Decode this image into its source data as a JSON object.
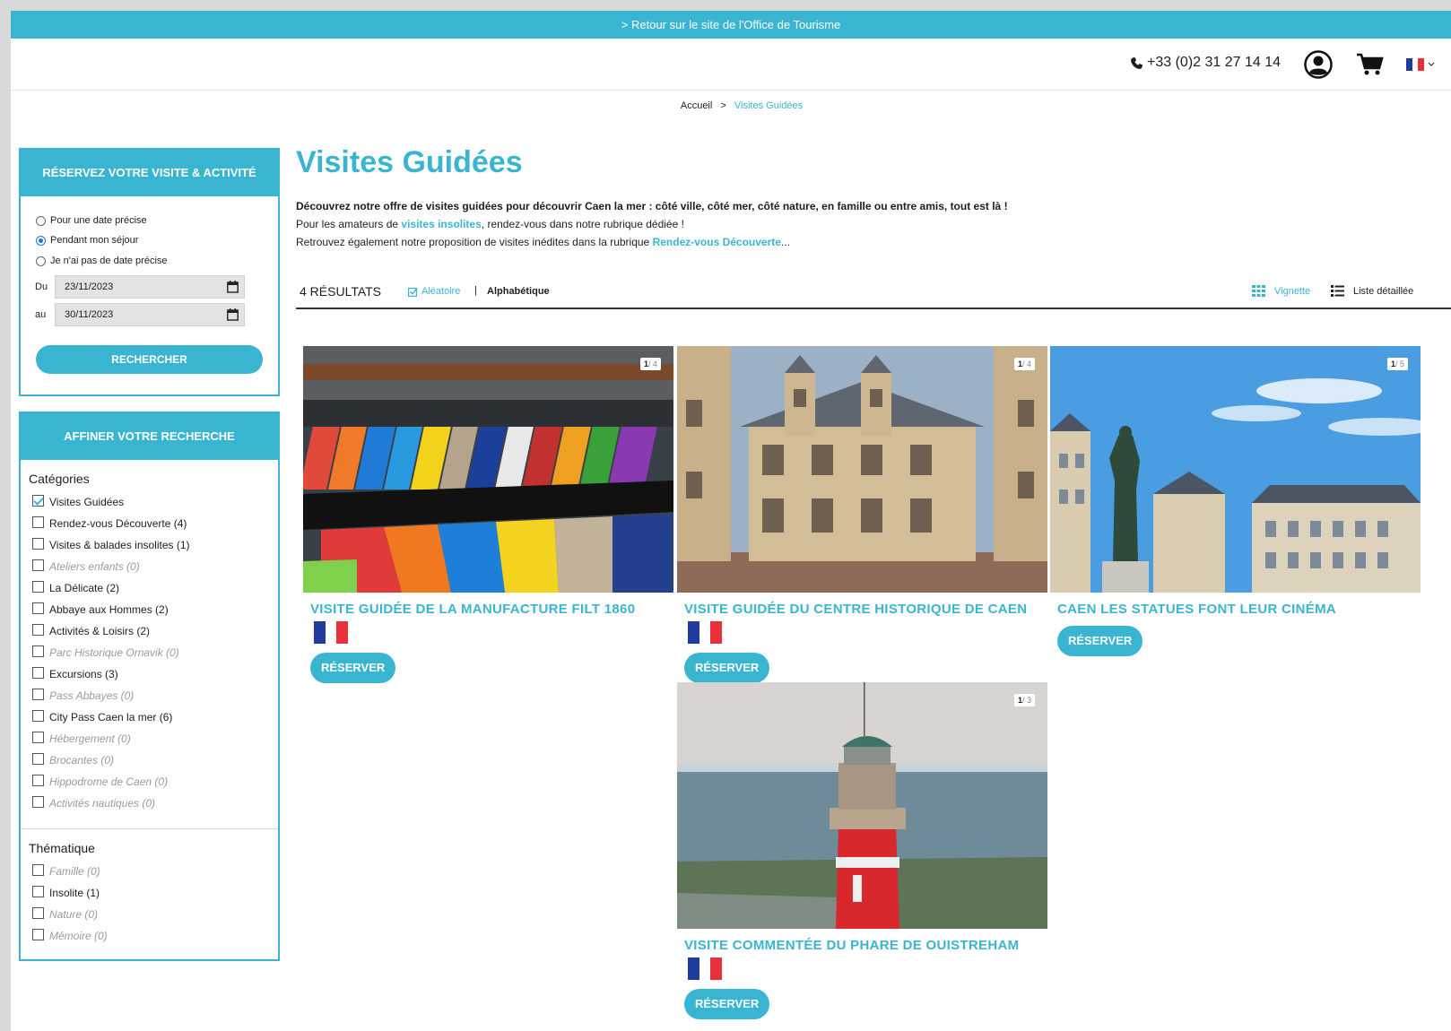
{
  "topbar": {
    "link": "> Retour sur le site de l'Office de Tourisme"
  },
  "header": {
    "phone": "+33 (0)2 31 27 14 14",
    "user_icon": "user-circle-icon",
    "cart_icon": "cart-icon",
    "language": "fr"
  },
  "breadcrumb": {
    "home": "Accueil",
    "separator": ">",
    "current": "Visites Guidées"
  },
  "booking": {
    "title": "RÉSERVEZ VOTRE VISITE & ACTIVITÉ",
    "options": [
      {
        "label": "Pour une date précise",
        "selected": false
      },
      {
        "label": "Pendant mon séjour",
        "selected": true
      },
      {
        "label": "Je n'ai pas de date précise",
        "selected": false
      }
    ],
    "from_label": "Du",
    "from_value": "23/11/2023",
    "to_label": "au",
    "to_value": "30/11/2023",
    "search_label": "RECHERCHER"
  },
  "filters": {
    "title": "AFFINER VOTRE RECHERCHE",
    "categories_title": "Catégories",
    "categories": [
      {
        "label": "Visites Guidées",
        "checked": true,
        "disabled": false
      },
      {
        "label": "Rendez-vous Découverte (4)",
        "checked": false,
        "disabled": false
      },
      {
        "label": "Visites & balades insolites (1)",
        "checked": false,
        "disabled": false
      },
      {
        "label": "Ateliers enfants (0)",
        "checked": false,
        "disabled": true
      },
      {
        "label": "La Délicate (2)",
        "checked": false,
        "disabled": false
      },
      {
        "label": "Abbaye aux Hommes (2)",
        "checked": false,
        "disabled": false
      },
      {
        "label": "Activités & Loisirs (2)",
        "checked": false,
        "disabled": false
      },
      {
        "label": "Parc Historique Ornavik (0)",
        "checked": false,
        "disabled": true
      },
      {
        "label": "Excursions (3)",
        "checked": false,
        "disabled": false
      },
      {
        "label": "Pass Abbayes (0)",
        "checked": false,
        "disabled": true
      },
      {
        "label": "City Pass Caen la mer (6)",
        "checked": false,
        "disabled": false
      },
      {
        "label": "Hébergement (0)",
        "checked": false,
        "disabled": true
      },
      {
        "label": "Brocantes (0)",
        "checked": false,
        "disabled": true
      },
      {
        "label": "Hippodrome de Caen (0)",
        "checked": false,
        "disabled": true
      },
      {
        "label": "Activités nautiques (0)",
        "checked": false,
        "disabled": true
      }
    ],
    "themes_title": "Thématique",
    "themes": [
      {
        "label": "Famille (0)",
        "checked": false,
        "disabled": true
      },
      {
        "label": "Insolite (1)",
        "checked": false,
        "disabled": false
      },
      {
        "label": "Nature (0)",
        "checked": false,
        "disabled": true
      },
      {
        "label": "Mémoire (0)",
        "checked": false,
        "disabled": true
      }
    ]
  },
  "main": {
    "title": "Visites Guidées",
    "intro_bold": "Découvrez notre offre de visites guidées pour découvrir Caen la mer : côté ville, côté mer, côté nature, en famille ou entre amis, tout est là !",
    "intro_line2_a": "Pour les amateurs de ",
    "intro_line2_link": "visites insolites",
    "intro_line2_b": ", rendez-vous dans notre rubrique dédiée !",
    "intro_line3_a": "Retrouvez également notre proposition de visites inédites dans la rubrique ",
    "intro_line3_link": "Rendez-vous Découverte",
    "intro_line3_b": "...",
    "results_count": "4 RÉSULTATS",
    "sort_random": "Aléatoire",
    "sort_separator": "|",
    "sort_alpha": "Alphabétique",
    "view_grid": "Vignette",
    "view_list": "Liste détaillée"
  },
  "cards": [
    {
      "title": "VISITE GUIDÉE DE LA MANUFACTURE FILT 1860",
      "photo_index": "1",
      "photo_total": "/ 4",
      "button": "RÉSERVER",
      "flag": "fr"
    },
    {
      "title": "VISITE GUIDÉE DU CENTRE HISTORIQUE DE CAEN",
      "photo_index": "1",
      "photo_total": "/ 4",
      "button": "RÉSERVER",
      "flag": "fr"
    },
    {
      "title": "CAEN LES STATUES FONT LEUR CINÉMA",
      "photo_index": "1",
      "photo_total": "/ 5",
      "button": "RÉSERVER"
    },
    {
      "title": "VISITE COMMENTÉE DU PHARE DE OUISTREHAM",
      "photo_index": "1",
      "photo_total": "/ 3",
      "button": "RÉSERVER",
      "flag": "fr"
    }
  ],
  "colors": {
    "accent": "#3ab5d1",
    "flag_blue": "#1f3c9e",
    "flag_red": "#e8303a"
  }
}
